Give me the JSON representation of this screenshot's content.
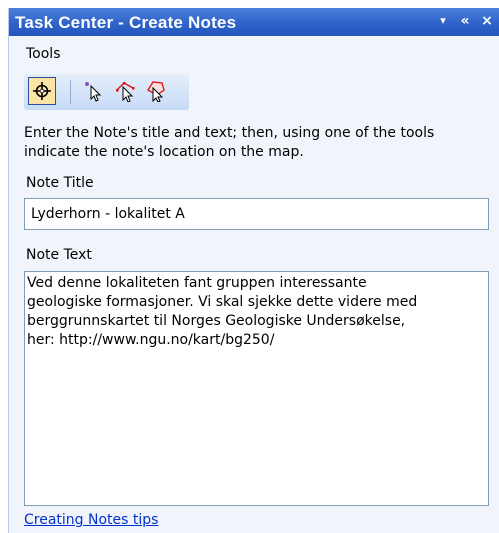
{
  "window": {
    "title": "Task Center - Create Notes",
    "controls": [
      "▾",
      "«",
      "×"
    ]
  },
  "tools_section": {
    "label": "Tools",
    "tools": [
      {
        "name": "point-location-tool",
        "icon": "crosshair-icon",
        "active": true
      },
      {
        "name": "line-tool",
        "icon": "sparkle-cursor-icon",
        "active": false
      },
      {
        "name": "polyline-tool",
        "icon": "polyline-cursor-icon",
        "active": false
      },
      {
        "name": "polygon-tool",
        "icon": "polygon-cursor-icon",
        "active": false
      }
    ]
  },
  "instructions": "Enter the Note's title and text; then, using one of the tools indicate the note's location on the map.",
  "note_title": {
    "label": "Note Title",
    "value": "Lyderhorn - lokalitet A"
  },
  "note_text": {
    "label": "Note Text",
    "value": "Ved denne lokaliteten fant gruppen interessante\ngeologiske formasjoner. Vi skal sjekke dette videre med\nberggrunnskartet til Norges Geologiske Undersøkelse,\nher: http://www.ngu.no/kart/bg250/"
  },
  "footer": {
    "link_label": "Creating Notes tips"
  },
  "colors": {
    "titlebar": "#2f63c9",
    "panel_bg": "#f1f5fb",
    "link": "#0033cc",
    "active_tool": "#fbe4a6"
  }
}
